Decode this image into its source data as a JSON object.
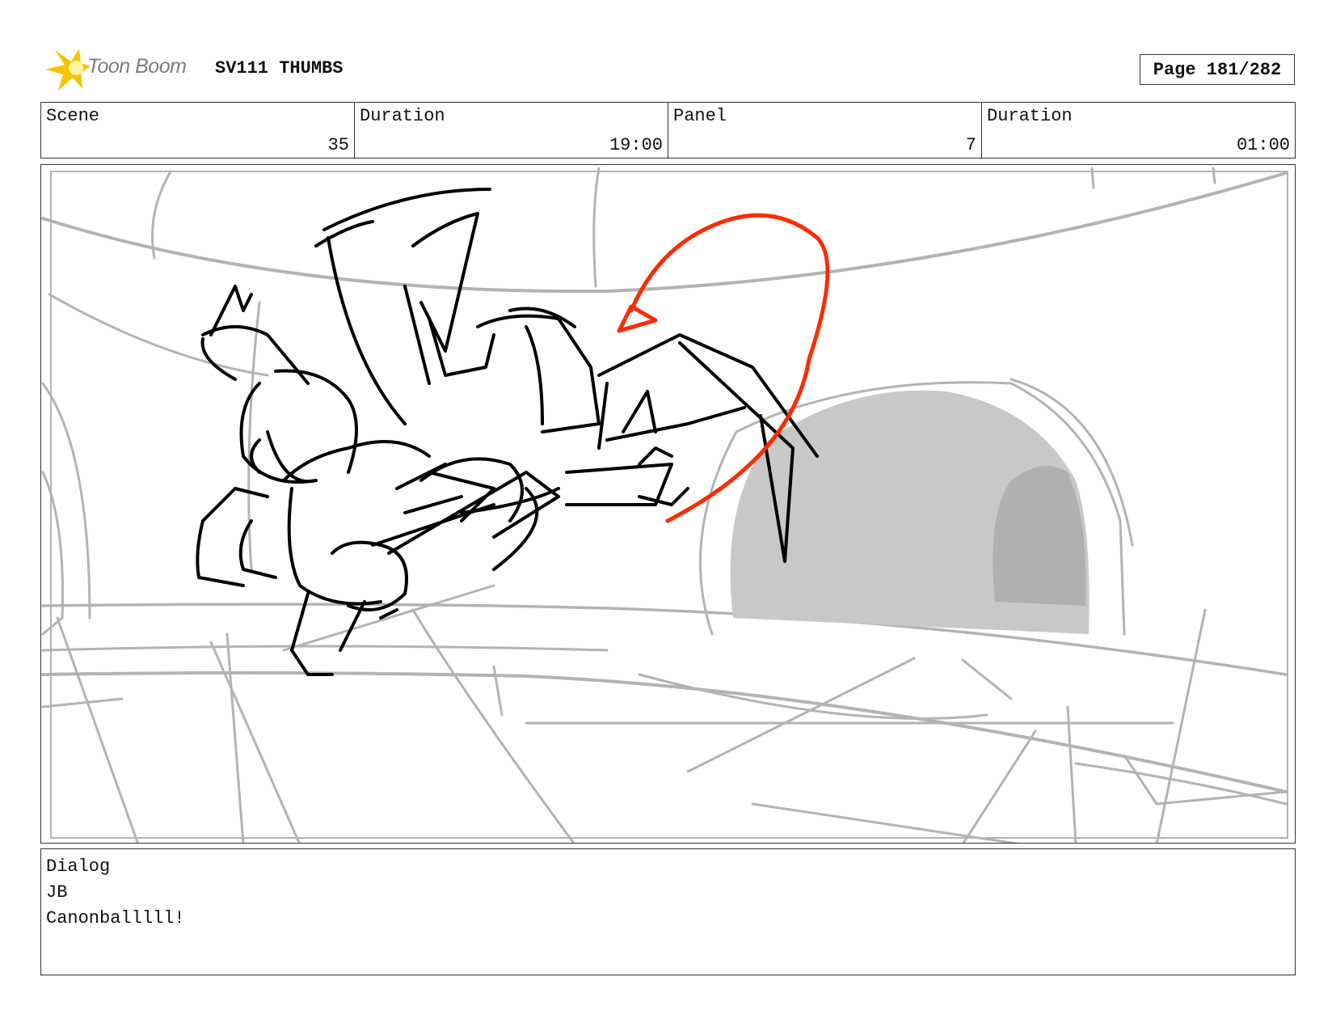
{
  "header": {
    "brand": "Toon Boom",
    "project_title": "SV111 THUMBS",
    "page_label": "Page 181/282"
  },
  "info": {
    "scene_label": "Scene",
    "scene_value": "35",
    "scene_duration_label": "Duration",
    "scene_duration_value": "19:00",
    "panel_label": "Panel",
    "panel_value": "7",
    "panel_duration_label": "Duration",
    "panel_duration_value": "01:00"
  },
  "dialog": {
    "label": "Dialog",
    "character": "JB",
    "line": "Canonballlll!"
  },
  "colors": {
    "action_arrow": "#ff2a00",
    "sketch_ink": "#000000",
    "background_sketch": "#b3b3b3",
    "tunnel_fill": "#c8c8c8",
    "brand_star": "#f5c400"
  }
}
